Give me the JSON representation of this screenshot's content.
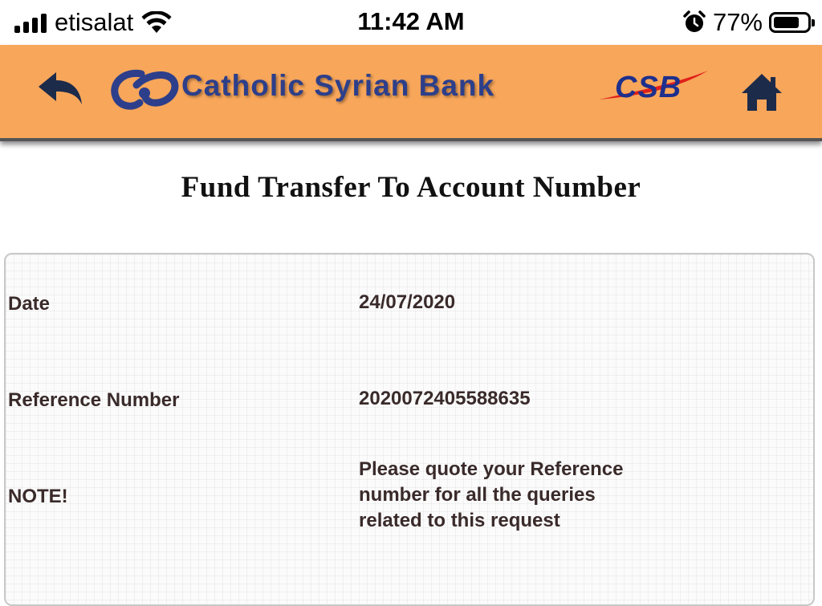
{
  "status_bar": {
    "carrier": "etisalat",
    "time": "11:42 AM",
    "battery_percent": "77%",
    "battery_level": 0.77,
    "icons": [
      "signal-icon",
      "wifi-icon",
      "alarm-icon",
      "battery-icon"
    ]
  },
  "header": {
    "bank_name": "Catholic Syrian Bank",
    "short_logo_text": "CSB",
    "icons": [
      "back-arrow-icon",
      "bank-logo-icon",
      "home-icon"
    ],
    "colors": {
      "background": "#f7a65a",
      "brand_blue": "#2d3f8a",
      "accent_red": "#e0201b",
      "icon_dark": "#1d2b4a"
    }
  },
  "page": {
    "title": "Fund Transfer To Account Number"
  },
  "details": {
    "date_label": "Date",
    "date_value": "24/07/2020",
    "reference_label": "Reference Number",
    "reference_value": "2020072405588635",
    "note_label": "NOTE!",
    "note_value_lines": [
      "Please quote your Reference",
      "number for all the queries",
      "related to this request"
    ]
  }
}
